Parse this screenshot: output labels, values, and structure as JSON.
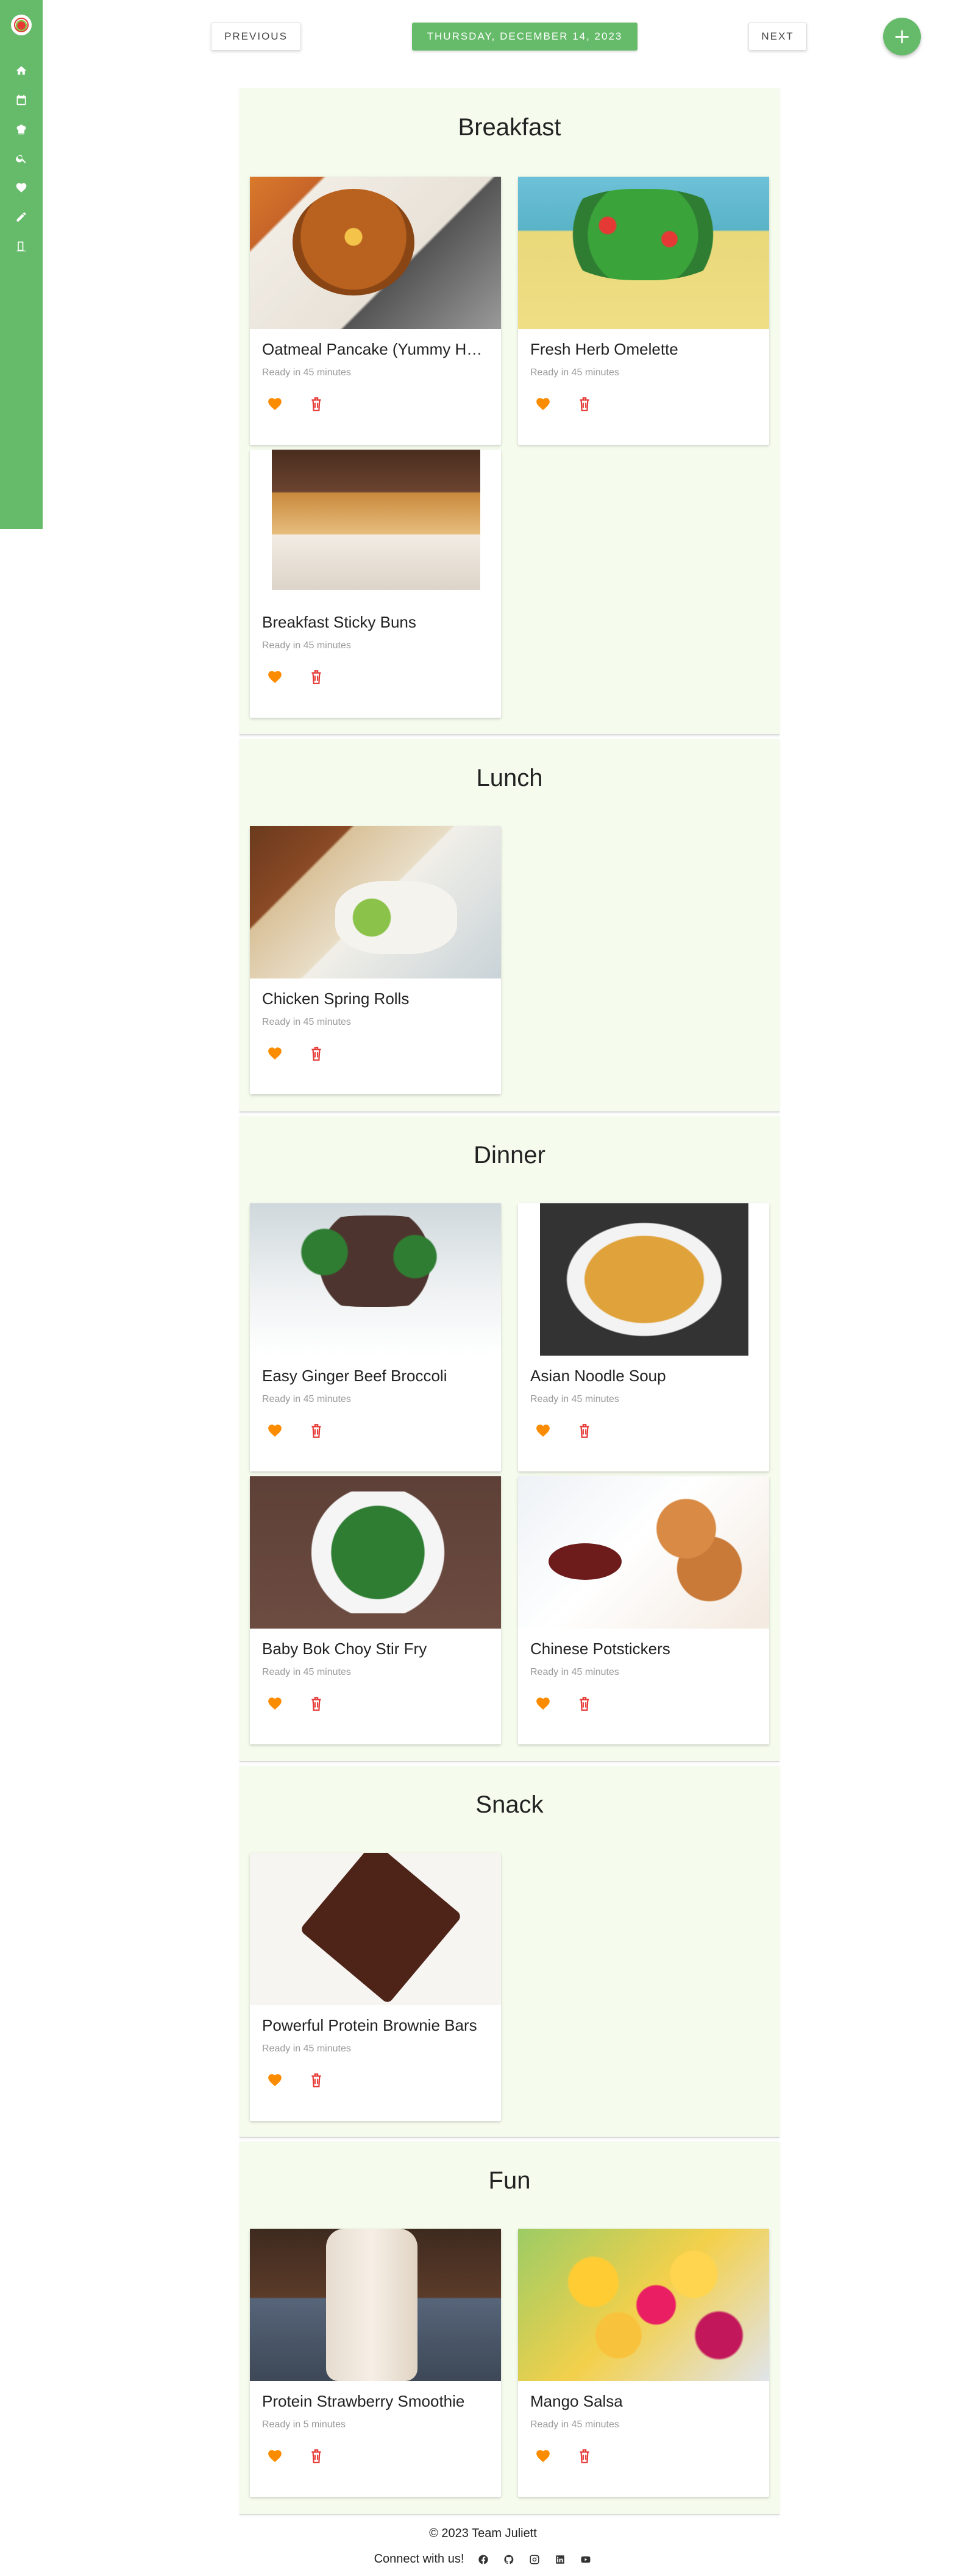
{
  "nav": {
    "previous_label": "PREVIOUS",
    "date_label": "THURSDAY, DECEMBER 14, 2023",
    "next_label": "NEXT",
    "add_label": "+"
  },
  "sidebar": {
    "items": [
      {
        "icon": "home-icon"
      },
      {
        "icon": "calendar-icon"
      },
      {
        "icon": "chef-hat-icon"
      },
      {
        "icon": "search-icon"
      },
      {
        "icon": "heart-icon"
      },
      {
        "icon": "pencil-icon"
      },
      {
        "icon": "logout-door-icon"
      }
    ]
  },
  "sections": {
    "breakfast": {
      "title": "Breakfast",
      "cards": [
        {
          "title": "Oatmeal Pancake (Yummy Healthy Breakfast)",
          "ready": "Ready in 45 minutes"
        },
        {
          "title": "Fresh Herb Omelette",
          "ready": "Ready in 45 minutes"
        },
        {
          "title": "Breakfast Sticky Buns",
          "ready": "Ready in 45 minutes"
        }
      ]
    },
    "lunch": {
      "title": "Lunch",
      "cards": [
        {
          "title": "Chicken Spring Rolls",
          "ready": "Ready in 45 minutes"
        }
      ]
    },
    "dinner": {
      "title": "Dinner",
      "cards": [
        {
          "title": "Easy Ginger Beef Broccoli",
          "ready": "Ready in 45 minutes"
        },
        {
          "title": "Asian Noodle Soup",
          "ready": "Ready in 45 minutes"
        },
        {
          "title": "Baby Bok Choy Stir Fry",
          "ready": "Ready in 45 minutes"
        },
        {
          "title": "Chinese Potstickers",
          "ready": "Ready in 45 minutes"
        }
      ]
    },
    "snack": {
      "title": "Snack",
      "cards": [
        {
          "title": "Powerful Protein Brownie Bars",
          "ready": "Ready in 45 minutes"
        }
      ]
    },
    "fun": {
      "title": "Fun",
      "cards": [
        {
          "title": "Protein Strawberry Smoothie",
          "ready": "Ready in 5 minutes"
        },
        {
          "title": "Mango Salsa",
          "ready": "Ready in 45 minutes"
        }
      ]
    }
  },
  "footer": {
    "copyright": "© 2023 Team Juliett",
    "connect": "Connect with us!",
    "social": [
      "facebook-icon",
      "github-icon",
      "instagram-icon",
      "linkedin-icon",
      "youtube-icon"
    ]
  },
  "colors": {
    "primary_green": "#66bb6a",
    "section_bg": "#f5fbed",
    "favorite_orange": "#fb8c00",
    "delete_red": "#e53935"
  }
}
